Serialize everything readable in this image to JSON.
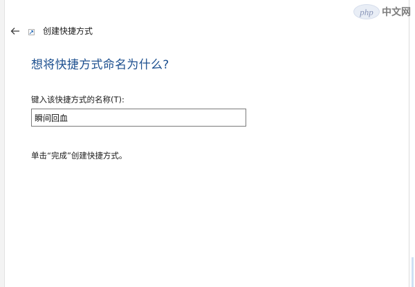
{
  "window": {
    "title": "创建快捷方式"
  },
  "watermark": {
    "logo_text": "php",
    "site_text": "中文网"
  },
  "wizard": {
    "heading": "想将快捷方式命名为什么?",
    "field_label": "键入该快捷方式的名称(T):",
    "name_value": "瞬间回血",
    "instruction": "单击“完成”创建快捷方式。"
  },
  "icons": {
    "back": "back-arrow-icon",
    "shortcut": "shortcut-icon"
  },
  "colors": {
    "heading": "#1c4f8f",
    "text": "#1a1a1a",
    "input_border": "#7a7a7a"
  }
}
